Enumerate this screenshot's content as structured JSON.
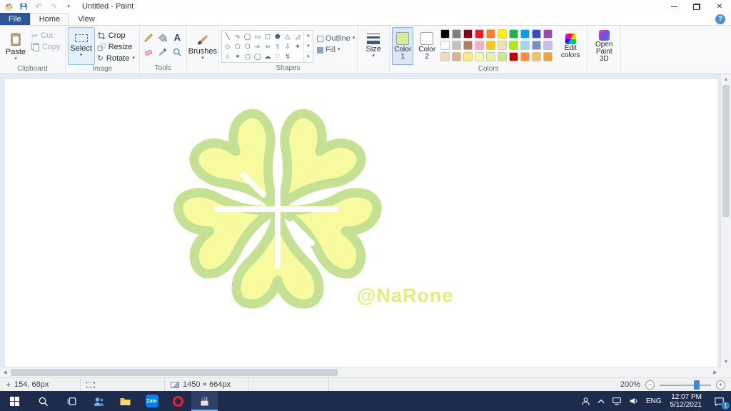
{
  "titlebar": {
    "title": "Untitled - Paint"
  },
  "tabs": {
    "file": "File",
    "home": "Home",
    "view": "View",
    "help": "?"
  },
  "ribbon": {
    "clipboard": {
      "group_label": "Clipboard",
      "paste": "Paste",
      "cut": "Cut",
      "copy": "Copy"
    },
    "image": {
      "group_label": "Image",
      "select": "Select",
      "crop": "Crop",
      "resize": "Resize",
      "rotate": "Rotate"
    },
    "tools": {
      "group_label": "Tools",
      "text_tool": "A"
    },
    "brushes": {
      "label": "Brushes"
    },
    "shapes": {
      "group_label": "Shapes",
      "outline": "Outline",
      "fill": "Fill",
      "gallery": [
        [
          "╲",
          "∿",
          "◯",
          "▭",
          "▢",
          "⬟",
          "△",
          "◿"
        ],
        [
          "◇",
          "⬠",
          "⬡",
          "⇨",
          "⇦",
          "⇧",
          "⇩",
          "✦"
        ],
        [
          "☆",
          "✶",
          "▢",
          "◯",
          "☁",
          "♡",
          "↯",
          ""
        ]
      ]
    },
    "size": {
      "label": "Size"
    },
    "colors": {
      "group_label": "Colors",
      "color1_label": "Color 1",
      "color2_label": "Color 2",
      "color1_value": "#d9ec9c",
      "color2_value": "#ffffff",
      "edit_colors": "Edit colors",
      "open_paint3d": "Open Paint 3D",
      "palette": [
        [
          "#000000",
          "#7f7f7f",
          "#880015",
          "#ed1c24",
          "#ff7f27",
          "#fff200",
          "#22b14c",
          "#00a2e8",
          "#3f48cc",
          "#a349a4"
        ],
        [
          "#ffffff",
          "#c3c3c3",
          "#b97a57",
          "#ffaec9",
          "#ffc90e",
          "#efe4b0",
          "#b5e61d",
          "#99d9ea",
          "#7092be",
          "#c8bfe7"
        ],
        [
          "#f0dcb4",
          "#e2b187",
          "#ffe97a",
          "#f7f7a8",
          "#e9f59c",
          "#cfe98a",
          "#c00000",
          "#ff8a3c",
          "#f3c169",
          "#f0a03c"
        ]
      ]
    }
  },
  "canvas": {
    "watermark": "@NaRone",
    "watermark_color": "#dfef78",
    "flower": {
      "petal_fill": "#f7fa9f",
      "petal_stroke": "#c5e193",
      "center_lines": "#ffffff"
    }
  },
  "statusbar": {
    "cursor_position": "154, 68px",
    "canvas_size": "1450 × 664px",
    "zoom_level": "200%"
  },
  "taskbar": {
    "language": "ENG",
    "time": "12:07 PM",
    "date": "5/12/2021",
    "zalo_label": "Zalo",
    "notification_badge": "1"
  }
}
